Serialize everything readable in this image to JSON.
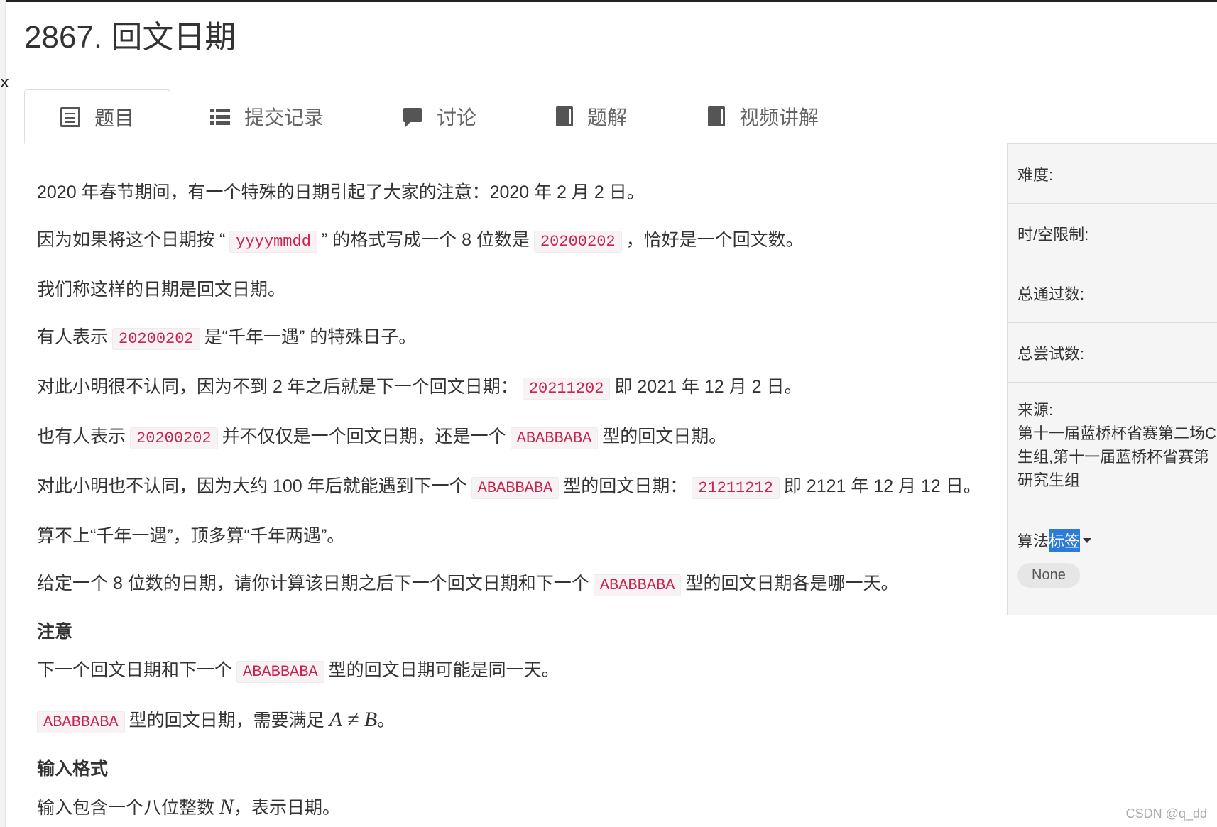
{
  "title": "2867. 回文日期",
  "stray_char": "x",
  "tabs": [
    {
      "label": "题目",
      "icon": "list-box-icon"
    },
    {
      "label": "提交记录",
      "icon": "list-icon"
    },
    {
      "label": "讨论",
      "icon": "comment-icon"
    },
    {
      "label": "题解",
      "icon": "book-icon"
    },
    {
      "label": "视频讲解",
      "icon": "book-icon"
    }
  ],
  "problem": {
    "p1": {
      "a": "2020 年春节期间，有一个特殊的日期引起了大家的注意：2020 年 2 月 2 日。"
    },
    "p2": {
      "a": "因为如果将这个日期按 “",
      "code1": "yyyymmdd",
      "b": "” 的格式写成一个 8 位数是",
      "code2": "20200202",
      "c": "，恰好是一个回文数。"
    },
    "p3": {
      "a": "我们称这样的日期是回文日期。"
    },
    "p4": {
      "a": "有人表示",
      "code1": "20200202",
      "b": "是“千年一遇” 的特殊日子。"
    },
    "p5": {
      "a": "对此小明很不认同，因为不到 2 年之后就是下一个回文日期：",
      "code1": "20211202",
      "b": "即 2021 年 12 月 2 日。"
    },
    "p6": {
      "a": "也有人表示",
      "code1": "20200202",
      "b": "并不仅仅是一个回文日期，还是一个",
      "code2": "ABABBABA",
      "c": "型的回文日期。"
    },
    "p7": {
      "a": "对此小明也不认同，因为大约 100 年后就能遇到下一个",
      "code1": "ABABBABA",
      "b": "型的回文日期：",
      "code2": "21211212",
      "c": "即 2121 年 12 月 12 日。"
    },
    "p8": {
      "a": "算不上“千年一遇”，顶多算“千年两遇”。"
    },
    "p9": {
      "a": "给定一个 8 位数的日期，请你计算该日期之后下一个回文日期和下一个",
      "code1": "ABABBABA",
      "b": "型的回文日期各是哪一天。"
    },
    "note_heading": "注意",
    "n1": {
      "a": "下一个回文日期和下一个",
      "code1": "ABABBABA",
      "b": "型的回文日期可能是同一天。"
    },
    "n2": {
      "code1": "ABABBABA",
      "a": "型的回文日期，需要满足",
      "math": "A ≠ B",
      "b": "。"
    },
    "input_heading": "输入格式",
    "i1": {
      "a": "输入包含一个八位整数",
      "math": "N",
      "b": "，表示日期。"
    }
  },
  "sidebar": {
    "difficulty_label": "难度:",
    "limit_label": "时/空限制:",
    "passed_label": "总通过数:",
    "tried_label": "总尝试数:",
    "source_label": "来源:",
    "source_lines": [
      "第十一届蓝桥杯省赛第二场C",
      "生组,第十一届蓝桥杯省赛第",
      "研究生组"
    ],
    "tags_label_a": "算法",
    "tags_label_b": "标签",
    "tag": "None"
  },
  "watermark": "CSDN @q_dd"
}
